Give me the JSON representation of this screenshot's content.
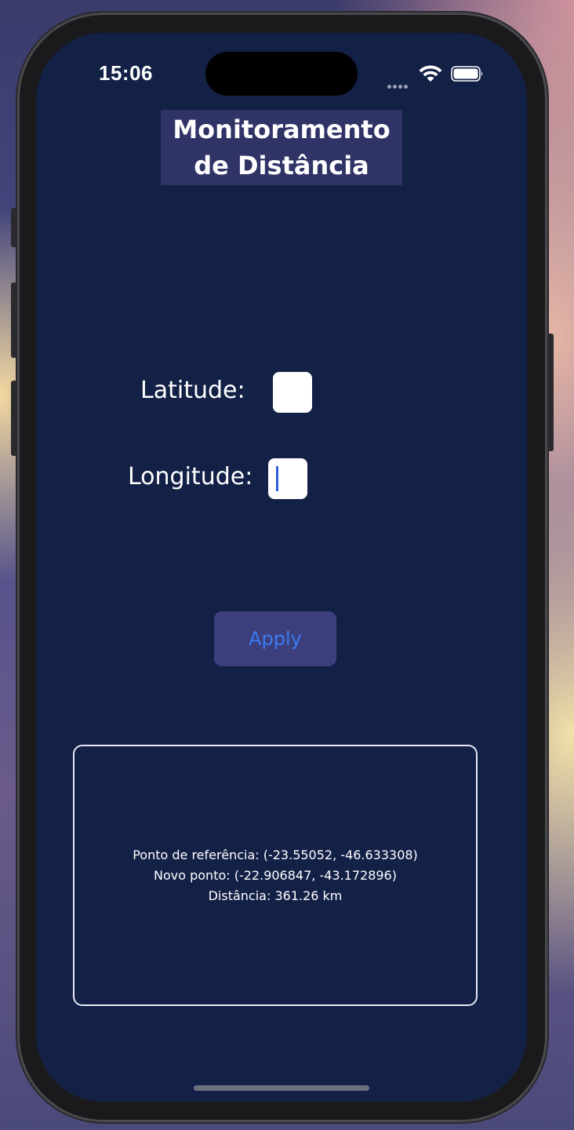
{
  "status_bar": {
    "time": "15:06",
    "icons": [
      "cellular-dots-icon",
      "wifi-icon",
      "battery-icon"
    ]
  },
  "header": {
    "title": "Monitoramento de Distância"
  },
  "form": {
    "latitude_label": "Latitude:",
    "latitude_value": "",
    "longitude_label": "Longitude:",
    "longitude_value": ""
  },
  "apply_button": {
    "label": "Apply"
  },
  "result": {
    "reference_point": "Ponto de referência: (-23.55052, -46.633308)",
    "new_point": "Novo ponto: (-22.906847, -43.172896)",
    "distance": "Distância: 361.26 km"
  },
  "colors": {
    "screen_background": "#142147",
    "title_background": "#2f3366",
    "button_background": "#3c3f7c",
    "button_text": "#3a7bf2",
    "result_border": "#e6e8f2",
    "caret": "#2f5fe0"
  }
}
